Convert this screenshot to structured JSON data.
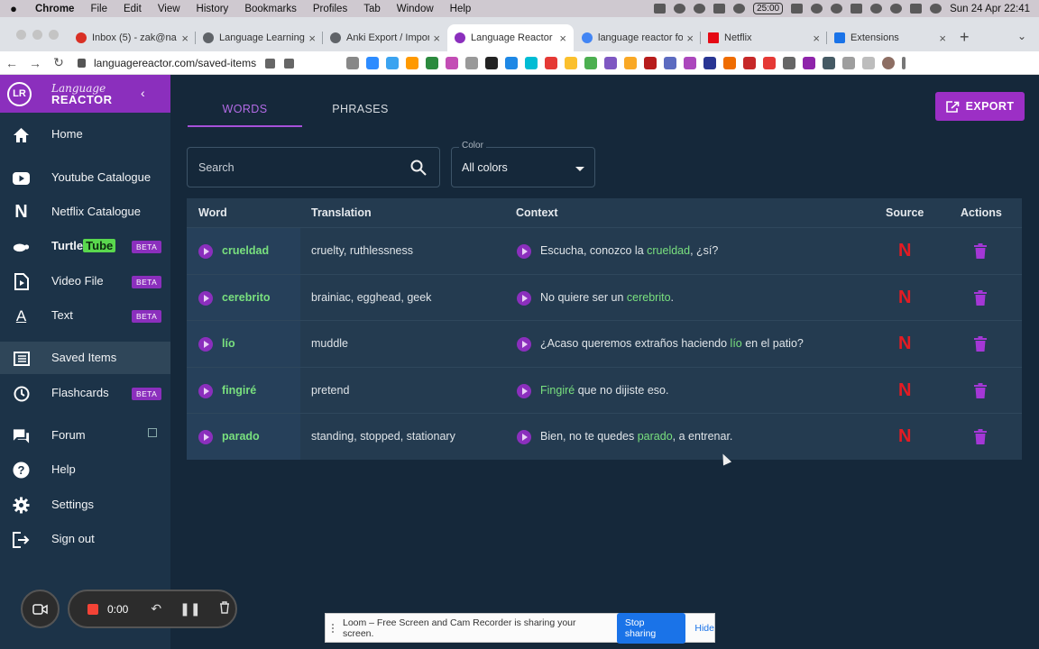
{
  "os_menu": {
    "app": "Chrome",
    "items": [
      "File",
      "Edit",
      "View",
      "History",
      "Bookmarks",
      "Profiles",
      "Tab",
      "Window",
      "Help"
    ],
    "timer": "25:00",
    "datetime": "Sun 24 Apr  22:41"
  },
  "browser": {
    "tabs": [
      {
        "title": "Inbox (5) - zak@na",
        "favicon_color": "#d93025"
      },
      {
        "title": "Language Learning",
        "favicon_color": "#5f6368"
      },
      {
        "title": "Anki Export / Impor",
        "favicon_color": "#5f6368"
      },
      {
        "title": "Language Reactor",
        "favicon_color": "#8b2fbd"
      },
      {
        "title": "language reactor fo",
        "favicon_color": "#4285f4"
      },
      {
        "title": "Netflix",
        "favicon_color": "#e50914"
      },
      {
        "title": "Extensions",
        "favicon_color": "#1a73e8"
      }
    ],
    "active_tab": 3,
    "url": "languagereactor.com/saved-items"
  },
  "sidebar": {
    "brand_top": "Language",
    "brand_bottom": "REACTOR",
    "badge": "LR",
    "items": [
      {
        "label": "Home",
        "icon": "home-icon"
      },
      {
        "label": "Youtube Catalogue",
        "icon": "youtube-icon"
      },
      {
        "label": "Netflix Catalogue",
        "icon": "netflix-icon"
      },
      {
        "label": "Turtle",
        "label2": "Tube",
        "icon": "turtle-icon",
        "beta": "BETA"
      },
      {
        "label": "Video File",
        "icon": "video-file-icon",
        "beta": "BETA"
      },
      {
        "label": "Text",
        "icon": "text-icon",
        "beta": "BETA"
      },
      {
        "label": "Saved Items",
        "icon": "list-icon"
      },
      {
        "label": "Flashcards",
        "icon": "clock-icon",
        "beta": "BETA"
      },
      {
        "label": "Forum",
        "icon": "forum-icon"
      },
      {
        "label": "Help",
        "icon": "help-icon"
      },
      {
        "label": "Settings",
        "icon": "gear-icon"
      },
      {
        "label": "Sign out",
        "icon": "sign-out-icon"
      }
    ]
  },
  "recorder": {
    "time": "0:00"
  },
  "main": {
    "tabs": [
      "WORDS",
      "PHRASES"
    ],
    "export_label": "EXPORT",
    "search_placeholder": "Search",
    "color_legend": "Color",
    "color_value": "All colors",
    "columns": [
      "Word",
      "Translation",
      "Context",
      "Source",
      "Actions"
    ],
    "rows": [
      {
        "word": "crueldad",
        "translation": "cruelty, ruthlessness",
        "ctx_pre": "Escucha, conozco la ",
        "ctx_hl": "crueldad",
        "ctx_post": ", ¿sí?",
        "source": "N"
      },
      {
        "word": "cerebrito",
        "translation": "brainiac, egghead, geek",
        "ctx_pre": "No quiere ser un ",
        "ctx_hl": "cerebrito",
        "ctx_post": ".",
        "source": "N"
      },
      {
        "word": "lío",
        "translation": "muddle",
        "ctx_pre": "¿Acaso queremos extraños haciendo ",
        "ctx_hl": "lío",
        "ctx_post": " en el patio?",
        "source": "N"
      },
      {
        "word": "fingiré",
        "translation": "pretend",
        "ctx_pre": "",
        "ctx_hl": "Fingiré",
        "ctx_post": " que no dijiste eso.",
        "source": "N"
      },
      {
        "word": "parado",
        "translation": "standing, stopped, stationary",
        "ctx_pre": "Bien, no te quedes ",
        "ctx_hl": "parado",
        "ctx_post": ", a entrenar.",
        "source": "N"
      }
    ]
  },
  "loom": {
    "message": "Loom – Free Screen and Cam Recorder is sharing your screen.",
    "stop": "Stop sharing",
    "hide": "Hide"
  }
}
